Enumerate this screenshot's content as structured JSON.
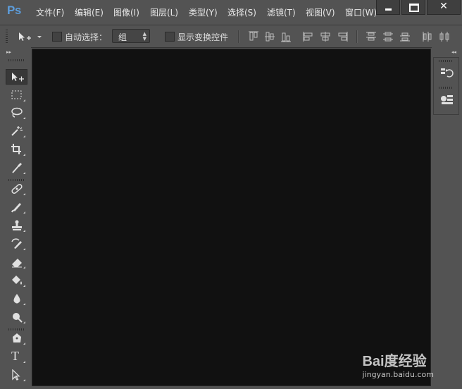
{
  "app": {
    "logo": "Ps"
  },
  "menu": [
    "文件(F)",
    "编辑(E)",
    "图像(I)",
    "图层(L)",
    "类型(Y)",
    "选择(S)",
    "滤镜(T)",
    "视图(V)",
    "窗口(W)"
  ],
  "window_controls": {
    "close_glyph": "✕"
  },
  "options": {
    "auto_select_label": "自动选择：",
    "auto_select_checked": false,
    "auto_select_target": "组",
    "show_transform_label": "显示变换控件",
    "show_transform_checked": false
  },
  "tools": [
    "move-tool",
    "marquee-tool",
    "lasso-tool",
    "magic-wand-tool",
    "crop-tool",
    "eyedropper-tool",
    "healing-brush-tool",
    "brush-tool",
    "clone-stamp-tool",
    "history-brush-tool",
    "eraser-tool",
    "paint-bucket-tool",
    "blur-tool",
    "dodge-tool",
    "pen-tool",
    "type-tool",
    "path-selection-tool"
  ],
  "type_tool_glyph": "T",
  "right_panel": [
    "history-icon",
    "properties-icon"
  ],
  "watermark": {
    "line1": "Bai度经验",
    "line2": "jingyan.baidu.com"
  },
  "colors": {
    "chrome": "#535353",
    "canvas": "#111111",
    "logo": "#5d9ddb"
  }
}
